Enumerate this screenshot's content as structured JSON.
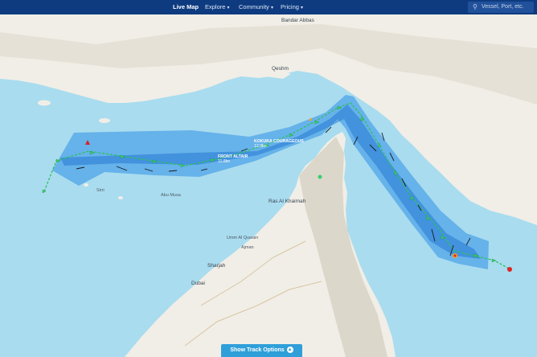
{
  "nav": {
    "live_map": "Live Map",
    "explore": "Explore",
    "community": "Community",
    "pricing": "Pricing"
  },
  "search": {
    "placeholder": "Vessel, Port, etc."
  },
  "vessels": [
    {
      "name": "FRONT ALTAIR",
      "speed": "11.8kn"
    },
    {
      "name": "KOKUKA COURAGEOUS",
      "speed": "12.9kn"
    }
  ],
  "places": [
    "Bandar Abbas",
    "Qeshm",
    "Ras Al Khaimah",
    "Umm Al Quwain",
    "Sharjah",
    "Dubai",
    "Ajman",
    "Abu Musa",
    "Sirri"
  ],
  "buttons": {
    "show_track_options": "Show Track Options"
  },
  "colors": {
    "nav_bg": "#0e3b80",
    "sea": "#a9dcef",
    "land": "#f1eee7",
    "track_band": "#2f8fe6",
    "track_line": "#2fc15a",
    "button": "#2f9fd9"
  },
  "icons": [
    "search-icon",
    "chevron-down-icon",
    "chevron-up-icon",
    "vessel-icon",
    "incident-marker-icon"
  ]
}
